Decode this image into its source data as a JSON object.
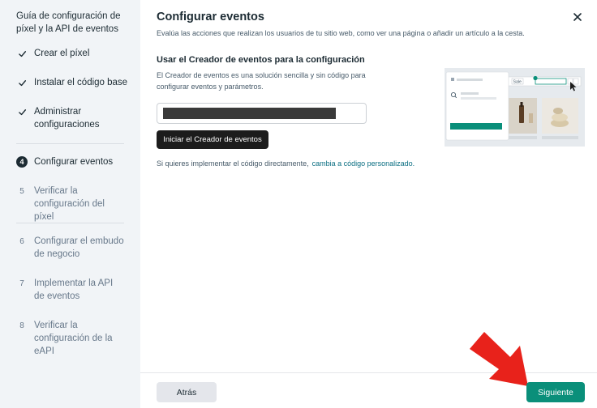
{
  "sidebar": {
    "title": "Guía de configuración de píxel y la API de eventos",
    "steps": [
      {
        "label": "Crear el píxel",
        "marker": "✓",
        "status": "done"
      },
      {
        "label": "Instalar el código base",
        "marker": "✓",
        "status": "done"
      },
      {
        "label": "Administrar configuraciones",
        "marker": "✓",
        "status": "done"
      },
      {
        "label": "Configurar eventos",
        "marker": "4",
        "status": "current"
      },
      {
        "label": "Verificar la configuración del píxel",
        "marker": "5",
        "status": "pending"
      },
      {
        "label": "Configurar el embudo de negocio",
        "marker": "6",
        "status": "pending"
      },
      {
        "label": "Implementar la API de eventos",
        "marker": "7",
        "status": "pending"
      },
      {
        "label": "Verificar la configuración de la eAPI",
        "marker": "8",
        "status": "pending"
      }
    ]
  },
  "main": {
    "title": "Configurar eventos",
    "subtitle": "Evalúa las acciones que realizan los usuarios de tu sitio web, como ver una página o añadir un artículo a la cesta.",
    "section_title": "Usar el Creador de eventos para la configuración",
    "section_desc": "El Creador de eventos es una solución sencilla y sin código para configurar eventos y parámetros.",
    "url_input_value": "",
    "start_button": "Iniciar el Creador de eventos",
    "direct_text": "Si quieres implementar el código directamente,",
    "direct_link": "cambia a código personalizado.",
    "illustration": {
      "sale_label": "Sale"
    }
  },
  "footer": {
    "back_label": "Atrás",
    "next_label": "Siguiente"
  },
  "colors": {
    "accent": "#0a8f7a",
    "link": "#0a6e82",
    "sidebar_bg": "#f1f4f7",
    "annotation_arrow": "#e8221b"
  },
  "icons": {
    "close": "close-icon",
    "check": "check-icon",
    "arrow": "red-arrow-icon"
  }
}
